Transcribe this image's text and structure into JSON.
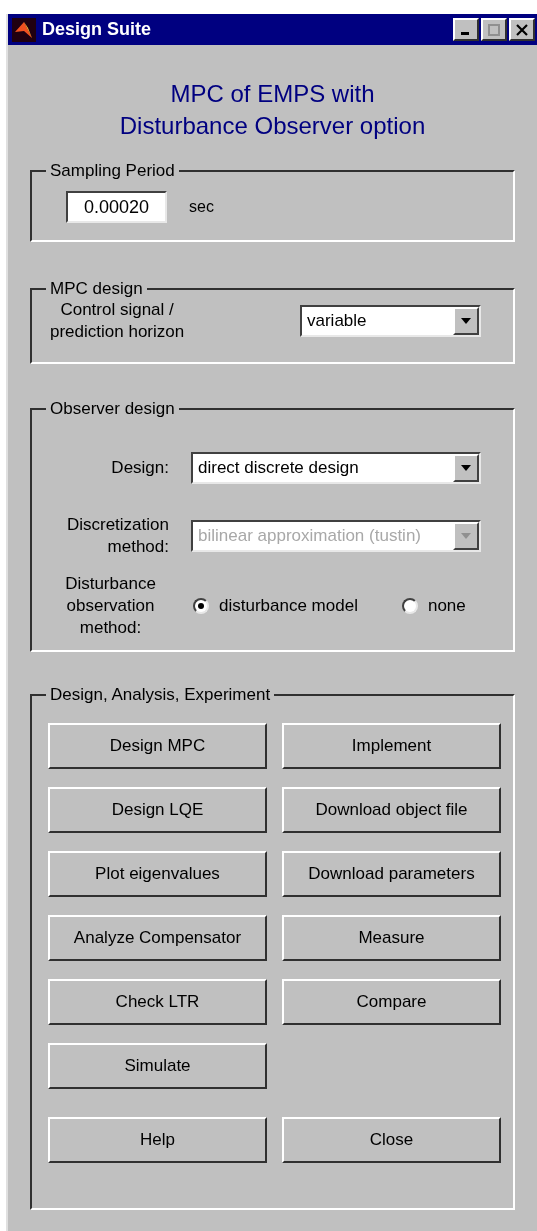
{
  "window": {
    "title": "Design Suite"
  },
  "heading": [
    "MPC of EMPS with",
    "Disturbance Observer option"
  ],
  "sampling": {
    "title": "Sampling  Period",
    "value": "0.00020",
    "unit": "sec"
  },
  "mpc": {
    "title": "MPC design",
    "label": "Control signal /\nprediction horizon",
    "dropdown": {
      "value": "variable",
      "disabled": false
    }
  },
  "observer": {
    "title": "Observer design",
    "fields": [
      {
        "label": "Design:",
        "value": "direct discrete design",
        "disabled": false
      },
      {
        "label": "Discretization\nmethod:",
        "value": "bilinear approximation (tustin)",
        "disabled": true
      }
    ],
    "method": {
      "label": "Disturbance\nobservation\nmethod:",
      "options": [
        {
          "label": "disturbance model",
          "selected": true
        },
        {
          "label": "none",
          "selected": false
        }
      ]
    }
  },
  "actions": {
    "title": "Design, Analysis, Experiment",
    "button_rows": [
      [
        "Design MPC",
        "Implement"
      ],
      [
        "Design LQE",
        "Download object file"
      ],
      [
        "Plot eigenvalues",
        "Download parameters"
      ],
      [
        "Analyze Compensator",
        "Measure"
      ],
      [
        "Check LTR",
        "Compare"
      ],
      [
        "Simulate"
      ]
    ],
    "footer_buttons": [
      "Help",
      "Close"
    ]
  }
}
